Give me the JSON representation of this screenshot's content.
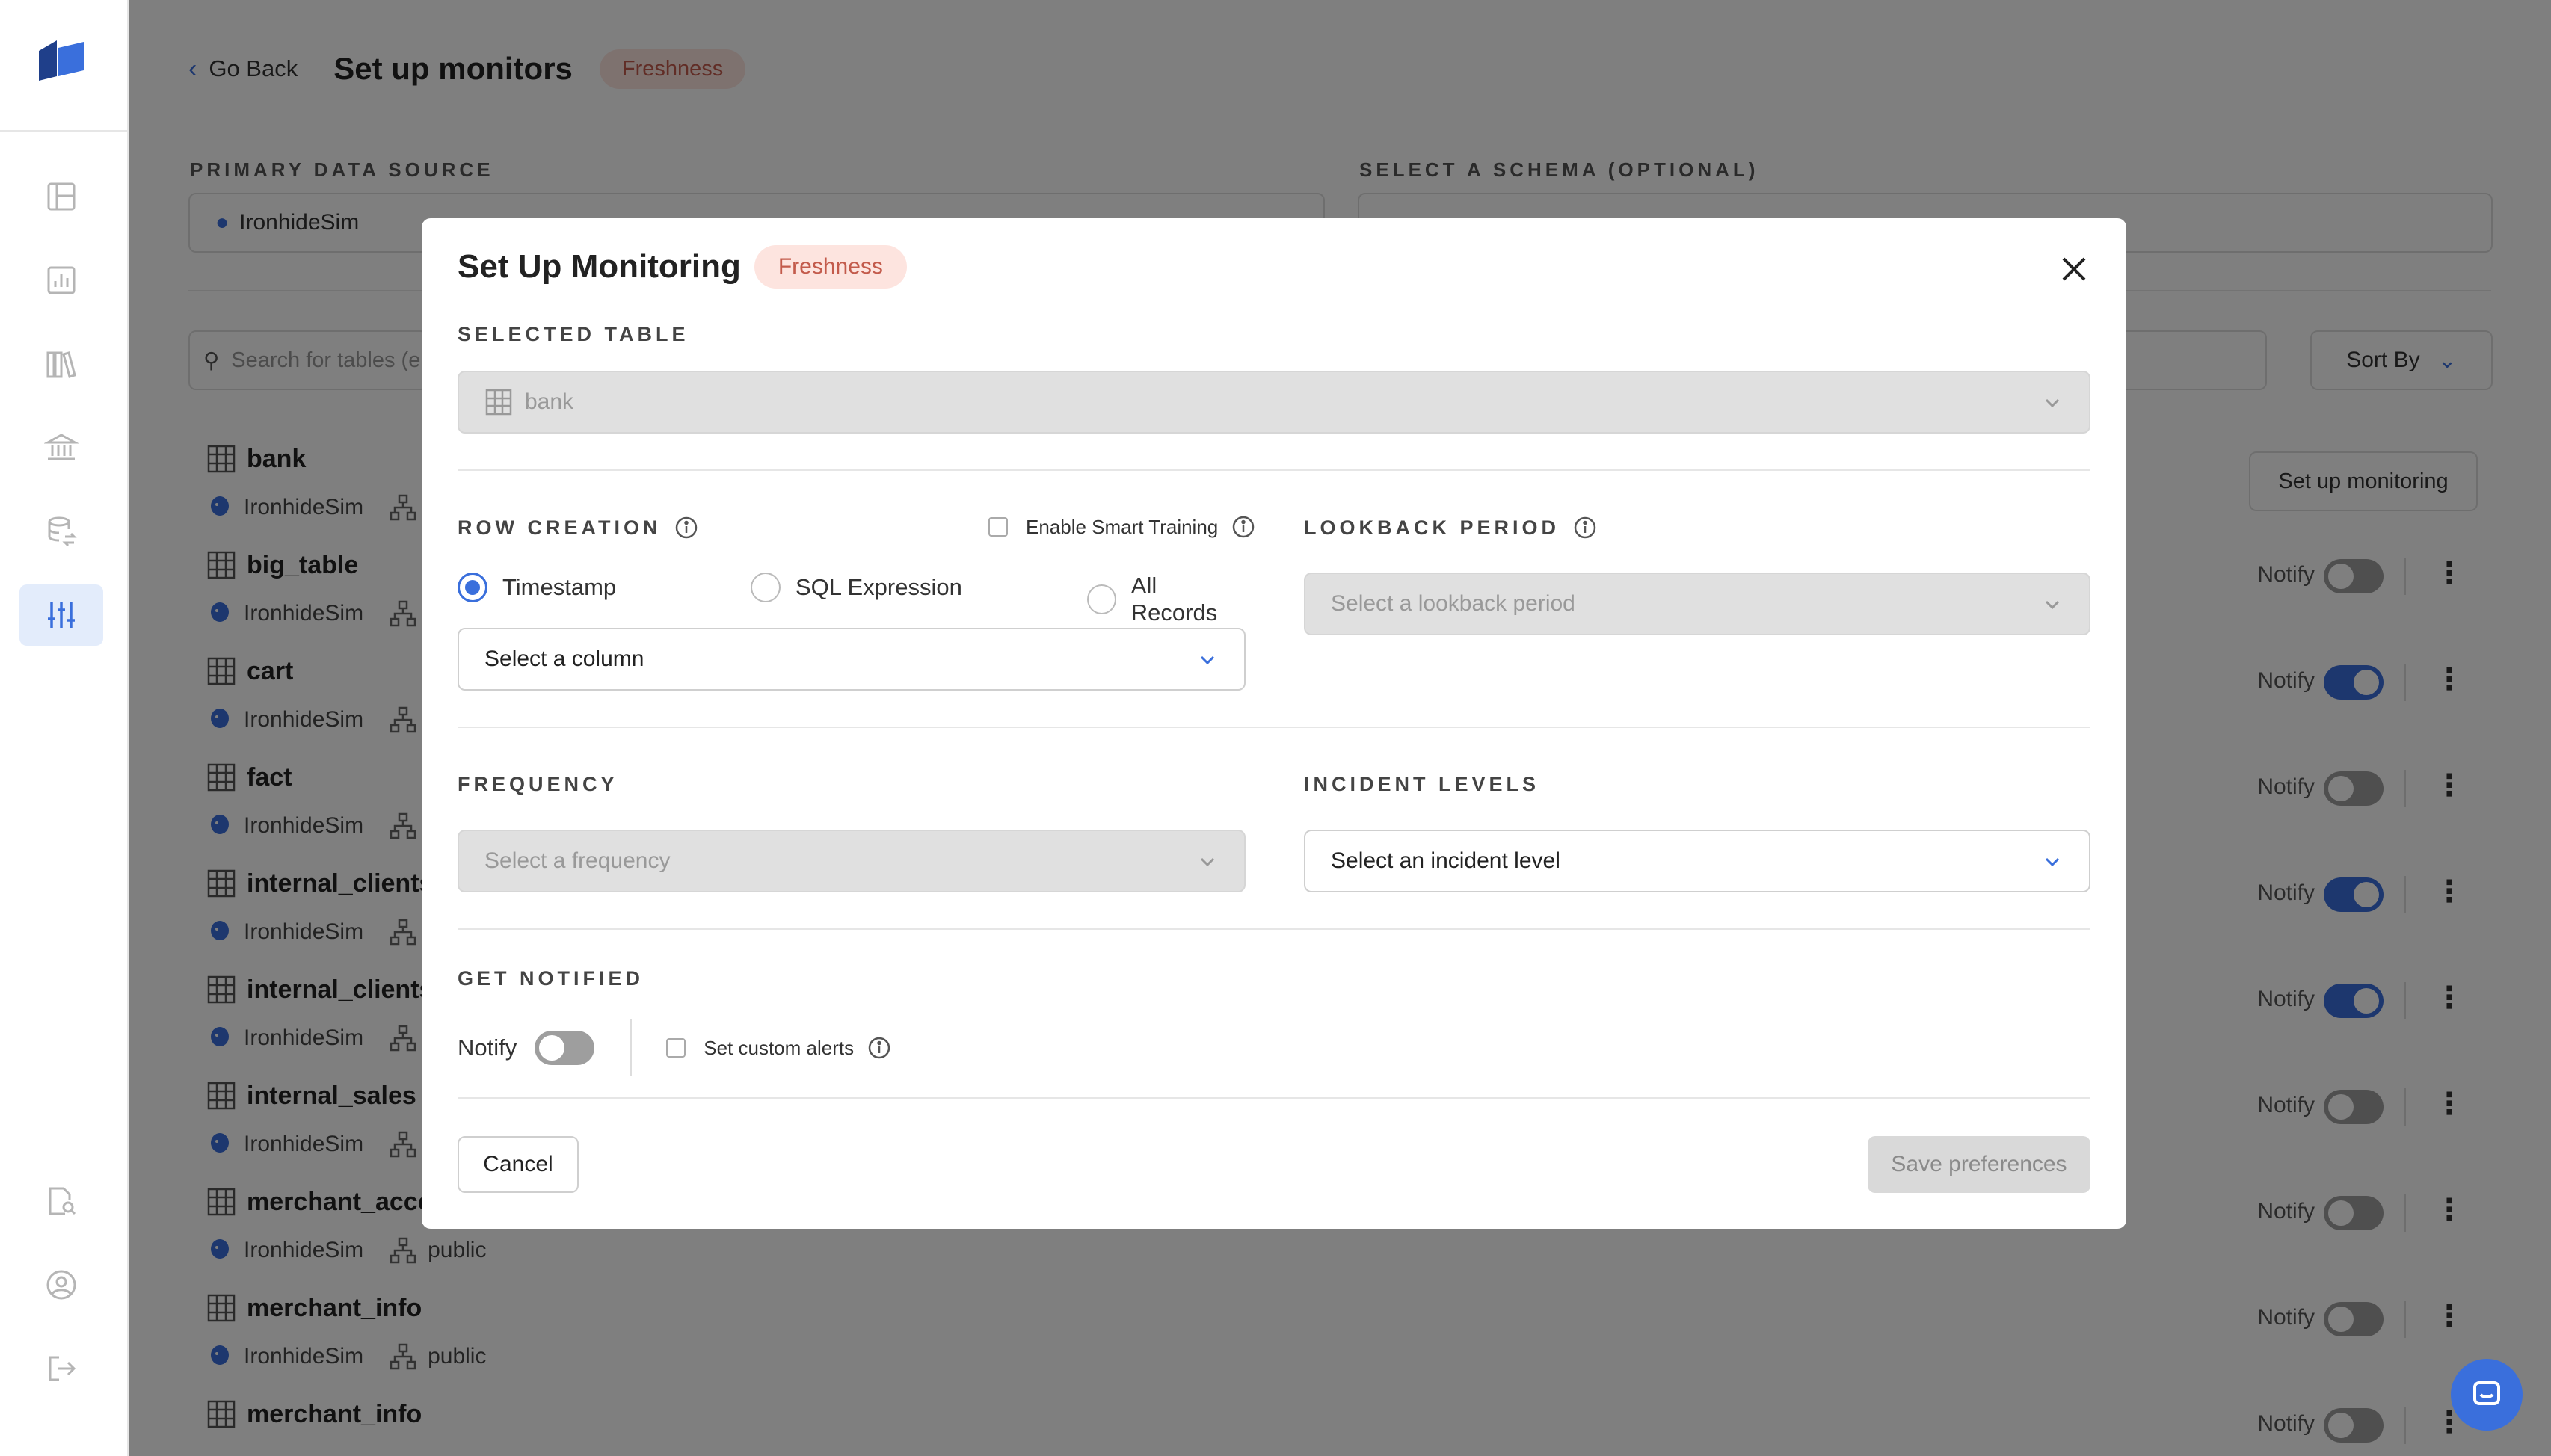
{
  "app": {
    "brand_color": "#3a6fdc",
    "overlay_color": "rgba(0,0,0,0.5)"
  },
  "sidebar": {
    "items": [
      {
        "icon": "layout-icon",
        "active": false
      },
      {
        "icon": "bar-chart-icon",
        "active": false
      },
      {
        "icon": "library-icon",
        "active": false
      },
      {
        "icon": "bank-icon",
        "active": false
      },
      {
        "icon": "database-sync-icon",
        "active": false
      },
      {
        "icon": "sliders-icon",
        "active": true
      }
    ],
    "bottom_items": [
      {
        "icon": "document-search-icon"
      },
      {
        "icon": "user-circle-icon"
      },
      {
        "icon": "logout-icon"
      }
    ]
  },
  "background": {
    "go_back": "Go Back",
    "title": "Set up monitors",
    "badge": "Freshness",
    "primary_source_label": "PRIMARY DATA SOURCE",
    "primary_source_value": "IronhideSim",
    "schema_label": "SELECT A SCHEMA (OPTIONAL)",
    "search_placeholder": "Search for tables (e",
    "sort_by": "Sort By",
    "setup_button": "Set up monitoring",
    "notify_label": "Notify",
    "rows": [
      {
        "name": "bank",
        "source": "IronhideSim",
        "schema": "",
        "notify": null
      },
      {
        "name": "big_table",
        "source": "IronhideSim",
        "schema": "",
        "notify": false
      },
      {
        "name": "cart",
        "source": "IronhideSim",
        "schema": "",
        "notify": true
      },
      {
        "name": "fact",
        "source": "IronhideSim",
        "schema": "",
        "notify": false
      },
      {
        "name": "internal_clients",
        "source": "IronhideSim",
        "schema": "",
        "notify": true
      },
      {
        "name": "internal_clients",
        "source": "IronhideSim",
        "schema": "",
        "notify": true
      },
      {
        "name": "internal_sales",
        "source": "IronhideSim",
        "schema": "",
        "notify": false
      },
      {
        "name": "merchant_acco",
        "source": "IronhideSim",
        "schema": "public",
        "notify": false
      },
      {
        "name": "merchant_info",
        "source": "IronhideSim",
        "schema": "public",
        "notify": false
      },
      {
        "name": "merchant_info",
        "source": "",
        "schema": "",
        "notify": false
      }
    ]
  },
  "modal": {
    "title": "Set Up Monitoring",
    "badge": "Freshness",
    "selected_table_label": "SELECTED TABLE",
    "selected_table_value": "bank",
    "row_creation_label": "ROW CREATION",
    "smart_training_label": "Enable Smart Training",
    "lookback_label": "LOOKBACK PERIOD",
    "lookback_placeholder": "Select a lookback period",
    "radio_options": [
      {
        "label": "Timestamp",
        "checked": true
      },
      {
        "label": "SQL Expression",
        "checked": false
      },
      {
        "label": "All Records",
        "checked": false
      }
    ],
    "column_placeholder": "Select a column",
    "frequency_label": "FREQUENCY",
    "frequency_placeholder": "Select a frequency",
    "incident_label": "INCIDENT LEVELS",
    "incident_placeholder": "Select an incident level",
    "notified_label": "GET NOTIFIED",
    "notify_label": "Notify",
    "notify_on": false,
    "custom_alerts_label": "Set custom alerts",
    "cancel": "Cancel",
    "save": "Save preferences"
  }
}
